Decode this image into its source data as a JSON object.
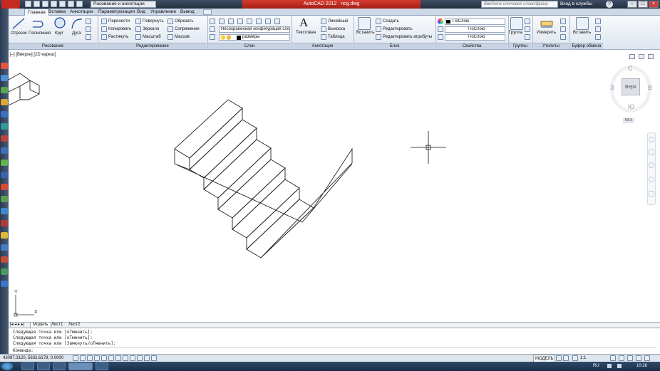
{
  "titlebar": {
    "workspace": "Рисование и аннотации",
    "app_title": "AutoCAD 2012",
    "file_name": "ncg.dwg",
    "search_placeholder": "Введите ключевое слово/фразу",
    "login": "Вход в службы",
    "help": "?"
  },
  "tabs": [
    "Главная",
    "Вставка",
    "Аннотации",
    "Параметризация",
    "Вид",
    "Управление",
    "Вывод"
  ],
  "ribbon": {
    "draw": {
      "footer": "Рисование",
      "tools": [
        "Отрезок",
        "Полилиния",
        "Круг",
        "Дуга"
      ]
    },
    "modify": {
      "footer": "Редактирование",
      "col1": [
        "Перенести",
        "Копировать",
        "Растянуть"
      ],
      "col2": [
        "Повернуть",
        "Зеркало",
        "Масштаб"
      ],
      "col3": [
        "Обрезать",
        "Сопряжение",
        "Массив"
      ]
    },
    "layers": {
      "footer": "Слои",
      "state": "Несохраненная конфигурация сло",
      "current": "размеры"
    },
    "annotations": {
      "footer": "Аннотации",
      "text": "Текстовая",
      "items": [
        "Линейный",
        "Выноска",
        "Таблица"
      ]
    },
    "block": {
      "footer": "Блок",
      "insert": "Вставить",
      "items": [
        "Создать",
        "Редактировать",
        "Редактировать атрибуты"
      ]
    },
    "properties": {
      "footer": "Свойства",
      "items": [
        "ПоСлою",
        "ПоСлою",
        "ПоСлою"
      ]
    },
    "groups": {
      "footer": "Группы",
      "label": "Группа"
    },
    "utilities": {
      "footer": "Утилиты",
      "label": "Измерить"
    },
    "clipboard": {
      "footer": "Буфер обмена",
      "label": "Вставить"
    }
  },
  "viewport_label": "[–] [Вверхн] [2D каркас]",
  "viewcube": {
    "n": "С",
    "s": "Ю",
    "w": "З",
    "e": "В",
    "face": "Верх",
    "ucs": "МСК"
  },
  "ucs": {
    "y": "Y",
    "x": "X"
  },
  "layout_tabs": [
    "Модель",
    "Лист1",
    "Лист2"
  ],
  "command": {
    "history": [
      "Следующая точка или [оТменить]:",
      "Следующая точка или [оТменить]:",
      "Следующая точка или [Замкнуть/оТменить]:"
    ],
    "prompt": "Команда:"
  },
  "status": {
    "coords": "43097.3120, 5632.6179, 0.0000",
    "model": "МОДЕЛЬ",
    "scale": "1:1"
  },
  "taskbar": {
    "lang": "RU",
    "time": "10:26"
  }
}
